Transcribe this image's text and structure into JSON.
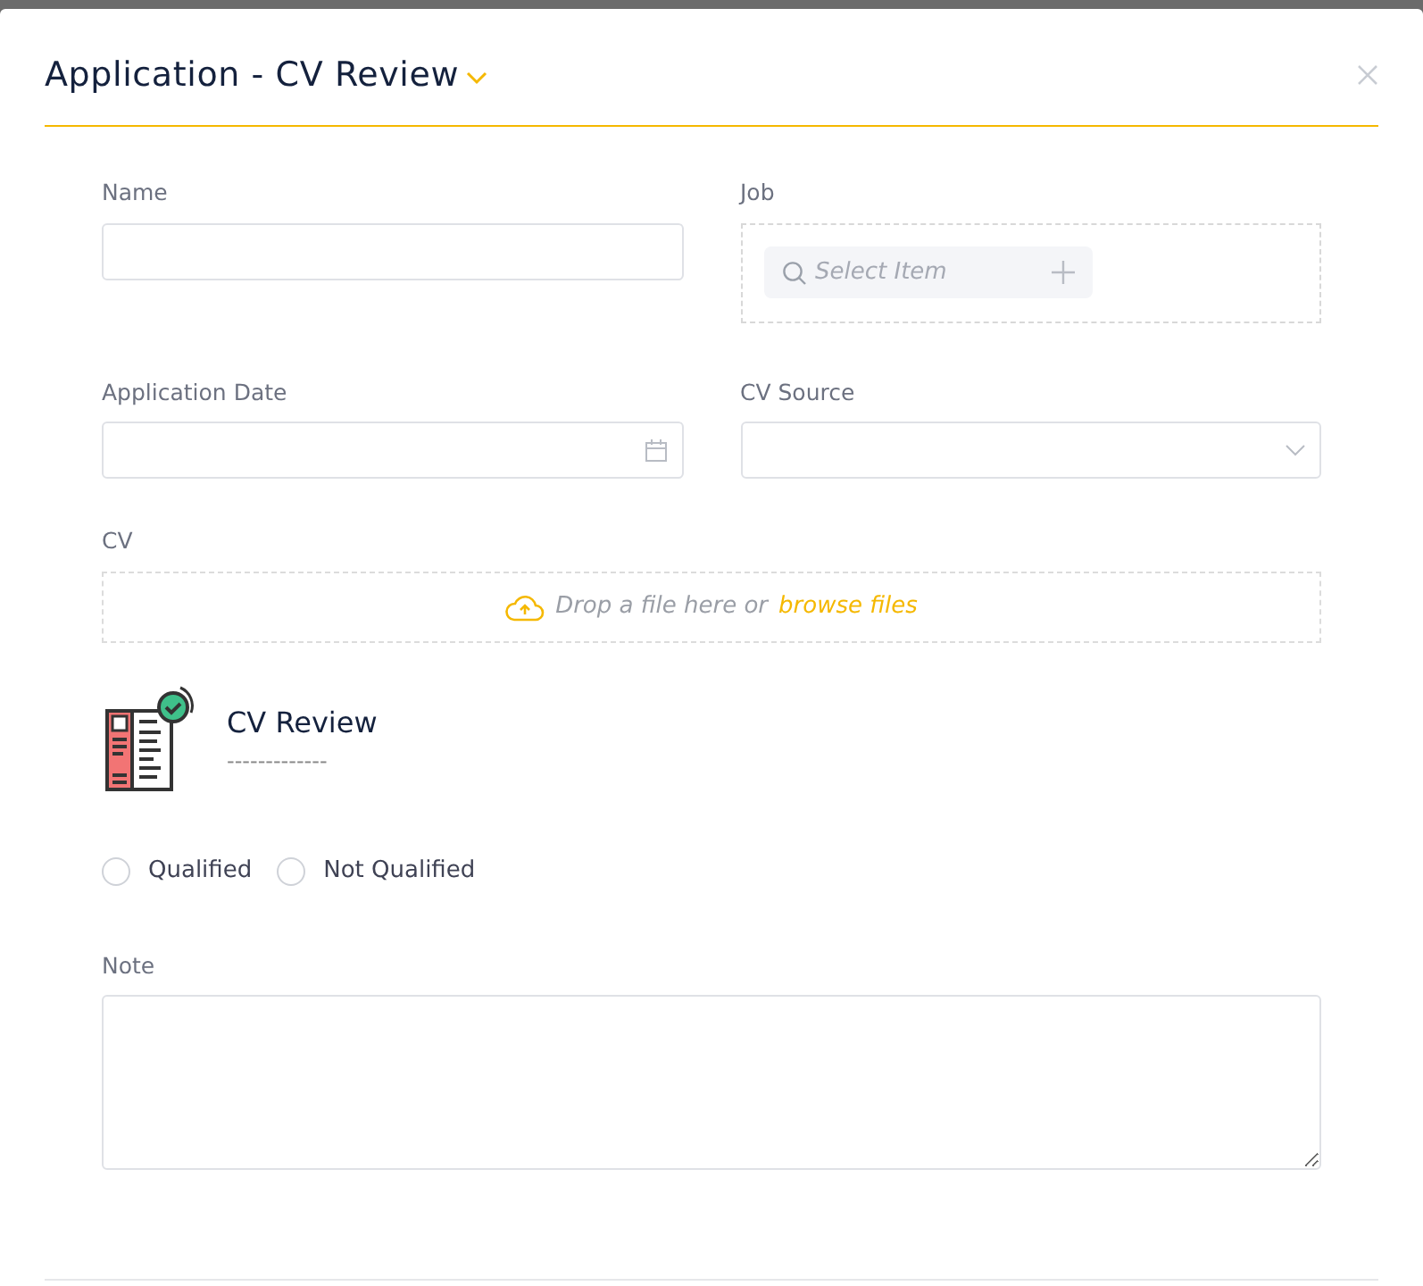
{
  "modal": {
    "title": "Application - CV Review"
  },
  "fields": {
    "name": {
      "label": "Name"
    },
    "job": {
      "label": "Job",
      "placeholder": "Select Item"
    },
    "application_date": {
      "label": "Application Date"
    },
    "cv_source": {
      "label": "CV Source"
    },
    "cv": {
      "label": "CV",
      "drop_text": "Drop a file here or",
      "browse_link": "browse files"
    }
  },
  "review": {
    "title": "CV Review",
    "subtitle": "-------------"
  },
  "result_options": [
    {
      "label": "Qualified",
      "selected": false
    },
    {
      "label": "Not Qualified",
      "selected": false
    }
  ],
  "note": {
    "label": "Note"
  }
}
